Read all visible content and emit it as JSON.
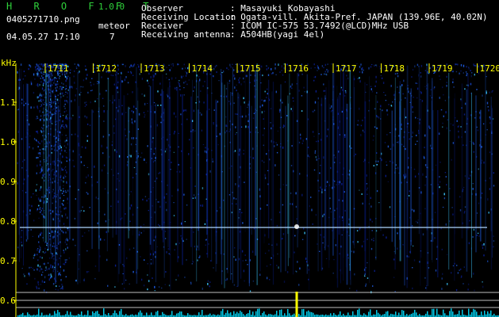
{
  "app": {
    "title": "H R O F F T",
    "version": "1.0.0"
  },
  "file": {
    "name": "0405271710.png",
    "datetime": "04.05.27 17:10",
    "meteor_label": "meteor",
    "meteor_count": "7"
  },
  "station": {
    "rows": [
      {
        "key": "Observer",
        "value": ": Masayuki Kobayashi"
      },
      {
        "key": "Receiving Location",
        "value": ": Ogata-vill. Akita-Pref. JAPAN (139.96E, 40.02N)"
      },
      {
        "key": "Receiver",
        "value": ": ICOM IC-575 53.7492(@LCD)MHz USB"
      },
      {
        "key": "Receiving antenna",
        "value": ": A504HB(yagi 4el)"
      }
    ]
  },
  "spectrogram": {
    "y_unit": "kHz",
    "y_ticks": [
      1.1,
      1.0,
      0.9,
      0.8,
      0.7,
      0.6
    ],
    "time_ticks": [
      "1711",
      "1712",
      "1713",
      "1714",
      "1715",
      "1716",
      "1717",
      "1718",
      "1719",
      "1720"
    ],
    "colors": {
      "background": "#000000",
      "signal_low": "#0a1e8c",
      "signal_mid": "#1e5adc",
      "signal_high": "#3cc8ff",
      "trace": "#b0d8ff",
      "axis": "#ffff00",
      "grid": "#ffffff",
      "level_bars": "#00c8e6",
      "meteor_spike": "#ffff00"
    }
  }
}
